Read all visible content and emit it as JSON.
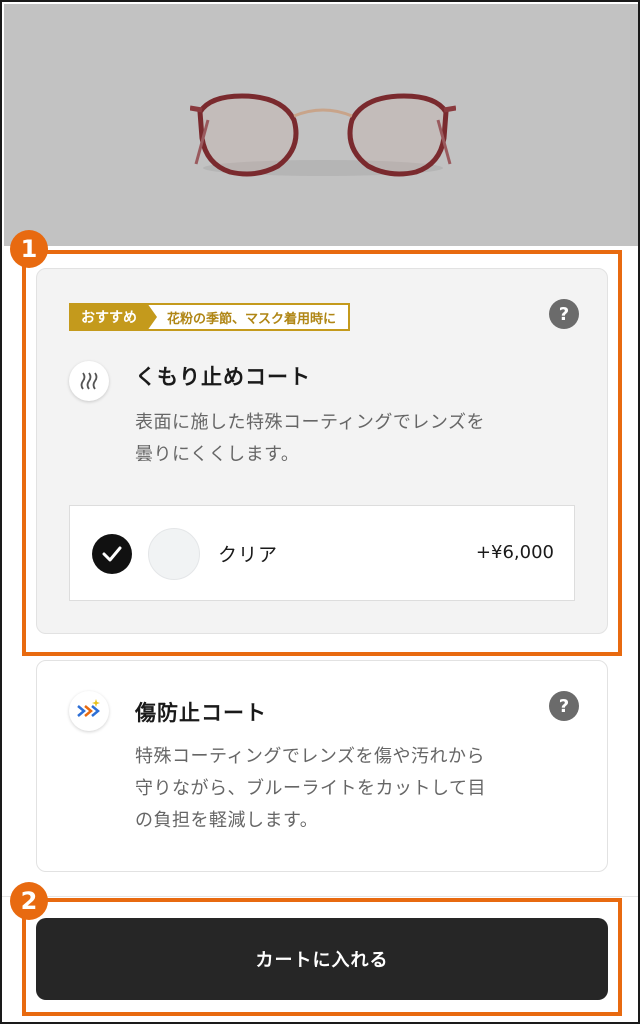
{
  "product": {
    "image_alt": "glasses-frame"
  },
  "anti_fog": {
    "badge_primary": "おすすめ",
    "badge_secondary": "花粉の季節、マスク着用時に",
    "help": "?",
    "title": "くもり止めコート",
    "description_line1": "表面に施した特殊コーティングでレンズを",
    "description_line2": "曇りにくくします。",
    "option": {
      "name": "クリア",
      "price": "+¥6,000",
      "selected": true
    }
  },
  "scratch": {
    "help": "?",
    "title": "傷防止コート",
    "description_line1": "特殊コーティングでレンズを傷や汚れから",
    "description_line2": "守りながら、ブルーライトをカットして目",
    "description_line3": "の負担を軽減します。"
  },
  "cart_button": {
    "label": "カートに入れる"
  },
  "annotations": [
    {
      "number": "1"
    },
    {
      "number": "2"
    }
  ],
  "colors": {
    "accent": "#e86a10",
    "badge_gold": "#c49a1c",
    "button_dark": "#262626"
  }
}
